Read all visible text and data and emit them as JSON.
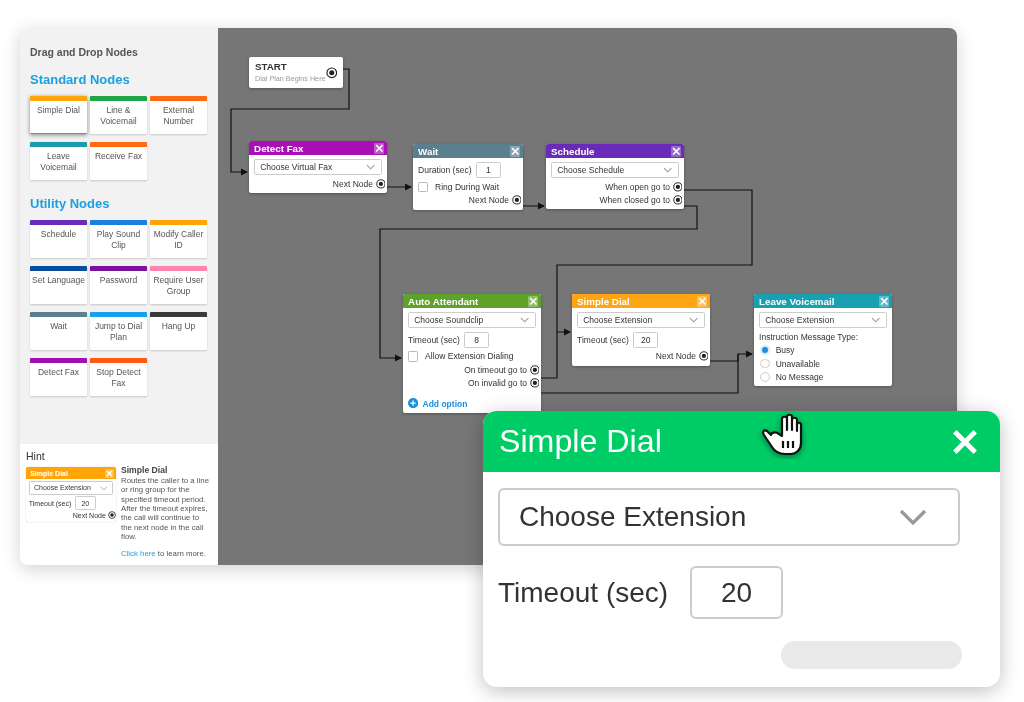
{
  "sidebar": {
    "title": "Drag and Drop Nodes",
    "sections": [
      {
        "heading": "Standard Nodes",
        "items": [
          {
            "label": "Simple Dial",
            "color": "#ffa50a",
            "selected": true
          },
          {
            "label": "Line & Voicemail",
            "color": "#1ea54a",
            "selected": false
          },
          {
            "label": "External Number",
            "color": "#ff6a13",
            "selected": false
          },
          {
            "label": "Leave Voicemail",
            "color": "#1a9ba8",
            "selected": false
          },
          {
            "label": "Receive Fax",
            "color": "#ff6a13",
            "selected": false
          }
        ]
      },
      {
        "heading": "Utility Nodes",
        "items": [
          {
            "label": "Schedule",
            "color": "#6a2cb8",
            "selected": false
          },
          {
            "label": "Play Sound Clip",
            "color": "#1e7fdc",
            "selected": false
          },
          {
            "label": "Modify Caller ID",
            "color": "#ffa50a",
            "selected": false
          },
          {
            "label": "Set Language",
            "color": "#0a4da0",
            "selected": false
          },
          {
            "label": "Password",
            "color": "#7a12a0",
            "selected": false
          },
          {
            "label": "Require User Group",
            "color": "#ff85b0",
            "selected": false
          },
          {
            "label": "Wait",
            "color": "#5a7f8f",
            "selected": false
          },
          {
            "label": "Jump to Dial Plan",
            "color": "#1aa0e8",
            "selected": false
          },
          {
            "label": "Hang Up",
            "color": "#3a3a3a",
            "selected": false
          },
          {
            "label": "Detect Fax",
            "color": "#a010b0",
            "selected": false
          },
          {
            "label": "Stop Detect Fax",
            "color": "#ff5a13",
            "selected": false
          }
        ]
      }
    ]
  },
  "hint": {
    "title": "Hint",
    "thumbnail": {
      "kind": "node",
      "title": "Simple Dial",
      "color": "#ffa50a",
      "rows": [
        {
          "kind": "dropdown",
          "text": "Choose Extension"
        },
        {
          "kind": "field",
          "label": "Timeout (sec)",
          "value": "20"
        },
        {
          "kind": "output",
          "label": "Next Node"
        }
      ]
    },
    "node_title": "Simple Dial",
    "description": "Routes the caller to a line or ring group for the specified timeout period. After the timeout expires, the call will continue to the next node in the call flow.",
    "link": "Click here",
    "link_suffix": "to learn more."
  },
  "nodes": [
    {
      "kind": "start",
      "title": "START",
      "subtitle": "Dial Plan Begins Here"
    },
    {
      "kind": "node",
      "title": "Detect Fax",
      "color": "#a80fb5",
      "rows": [
        {
          "kind": "dropdown",
          "text": "Choose Virtual Fax"
        },
        {
          "kind": "output",
          "label": "Next Node"
        }
      ]
    },
    {
      "kind": "node",
      "title": "Wait",
      "color": "#5a7f8f",
      "rows": [
        {
          "kind": "field",
          "label": "Duration (sec)",
          "value": "1"
        },
        {
          "kind": "checkbox",
          "label": "Ring During Wait",
          "checked": false
        },
        {
          "kind": "output",
          "label": "Next Node"
        }
      ]
    },
    {
      "kind": "node",
      "title": "Schedule",
      "color": "#6a2cb8",
      "rows": [
        {
          "kind": "dropdown",
          "text": "Choose Schedule"
        },
        {
          "kind": "output",
          "label": "When open go to"
        },
        {
          "kind": "output",
          "label": "When closed go to"
        }
      ]
    },
    {
      "kind": "node",
      "title": "Auto Attendant",
      "color": "#5ea22a",
      "rows": [
        {
          "kind": "dropdown",
          "text": "Choose Soundclip"
        },
        {
          "kind": "field",
          "label": "Timeout (sec)",
          "value": "8"
        },
        {
          "kind": "checkbox",
          "label": "Allow Extension Dialing",
          "checked": false
        },
        {
          "kind": "output",
          "label": "On timeout go to"
        },
        {
          "kind": "output",
          "label": "On invalid go to"
        },
        {
          "kind": "add",
          "label": "Add option"
        }
      ]
    },
    {
      "kind": "node",
      "title": "Simple Dial",
      "color": "#ffa514",
      "rows": [
        {
          "kind": "dropdown",
          "text": "Choose Extension"
        },
        {
          "kind": "field",
          "label": "Timeout (sec)",
          "value": "20"
        },
        {
          "kind": "output",
          "label": "Next Node"
        }
      ]
    },
    {
      "kind": "node",
      "title": "Leave Voicemail",
      "color": "#17a0b0",
      "rows": [
        {
          "kind": "dropdown",
          "text": "Choose Extension"
        },
        {
          "kind": "label",
          "text": "Instruction Message Type:"
        },
        {
          "kind": "radio",
          "label": "Busy",
          "selected": true
        },
        {
          "kind": "radio",
          "label": "Unavailable",
          "selected": false
        },
        {
          "kind": "radio",
          "label": "No Message",
          "selected": false
        }
      ]
    }
  ],
  "zoom_card": {
    "kind": "node",
    "title": "Simple Dial",
    "color": "#00cc66",
    "rows": [
      {
        "kind": "dropdown",
        "text": "Choose Extension"
      },
      {
        "kind": "field",
        "label": "Timeout (sec)",
        "value": "20"
      }
    ]
  }
}
